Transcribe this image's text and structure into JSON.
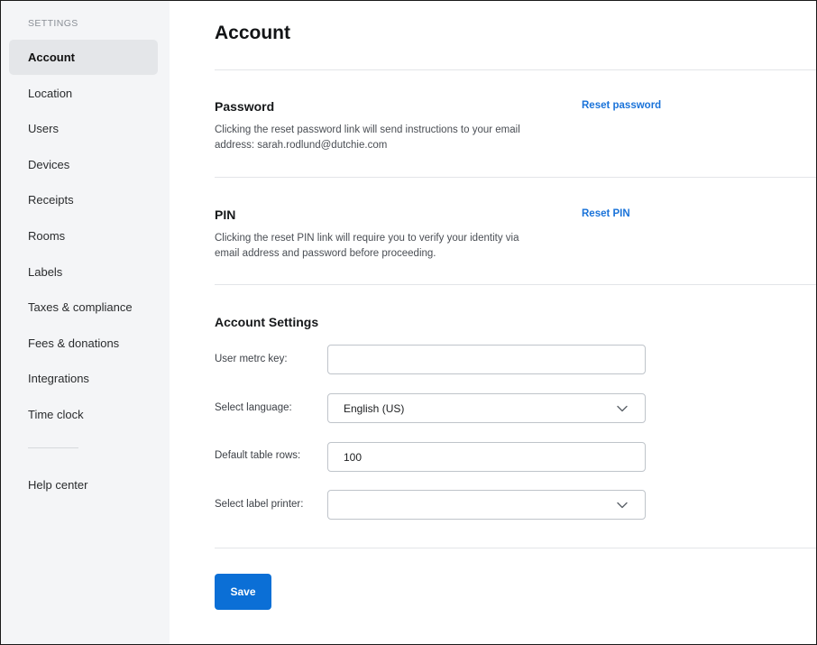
{
  "sidebar": {
    "heading": "SETTINGS",
    "items": [
      {
        "label": "Account",
        "active": true
      },
      {
        "label": "Location"
      },
      {
        "label": "Users"
      },
      {
        "label": "Devices"
      },
      {
        "label": "Receipts"
      },
      {
        "label": "Rooms"
      },
      {
        "label": "Labels"
      },
      {
        "label": "Taxes & compliance"
      },
      {
        "label": "Fees & donations"
      },
      {
        "label": "Integrations"
      },
      {
        "label": "Time clock"
      }
    ],
    "help": "Help center"
  },
  "main": {
    "title": "Account",
    "password": {
      "title": "Password",
      "description": "Clicking the reset password link will send instructions to your email address: sarah.rodlund@dutchie.com",
      "action": "Reset password"
    },
    "pin": {
      "title": "PIN",
      "description": "Clicking the reset PIN link will require you to verify your identity via email address and password before proceeding.",
      "action": "Reset PIN"
    },
    "account_settings": {
      "title": "Account Settings",
      "metrc_key": {
        "label": "User metrc key:",
        "value": ""
      },
      "language": {
        "label": "Select language:",
        "value": "English (US)"
      },
      "table_rows": {
        "label": "Default table rows:",
        "value": "100"
      },
      "label_printer": {
        "label": "Select label printer:",
        "value": ""
      }
    },
    "save_label": "Save"
  },
  "colors": {
    "accent": "#0b6fd6",
    "link": "#1a73d9",
    "sidebar_bg": "#f4f5f7",
    "active_item_bg": "#e4e6e9"
  },
  "icons": {
    "language_dropdown": "chevron-down-icon",
    "printer_dropdown": "chevron-down-icon"
  }
}
